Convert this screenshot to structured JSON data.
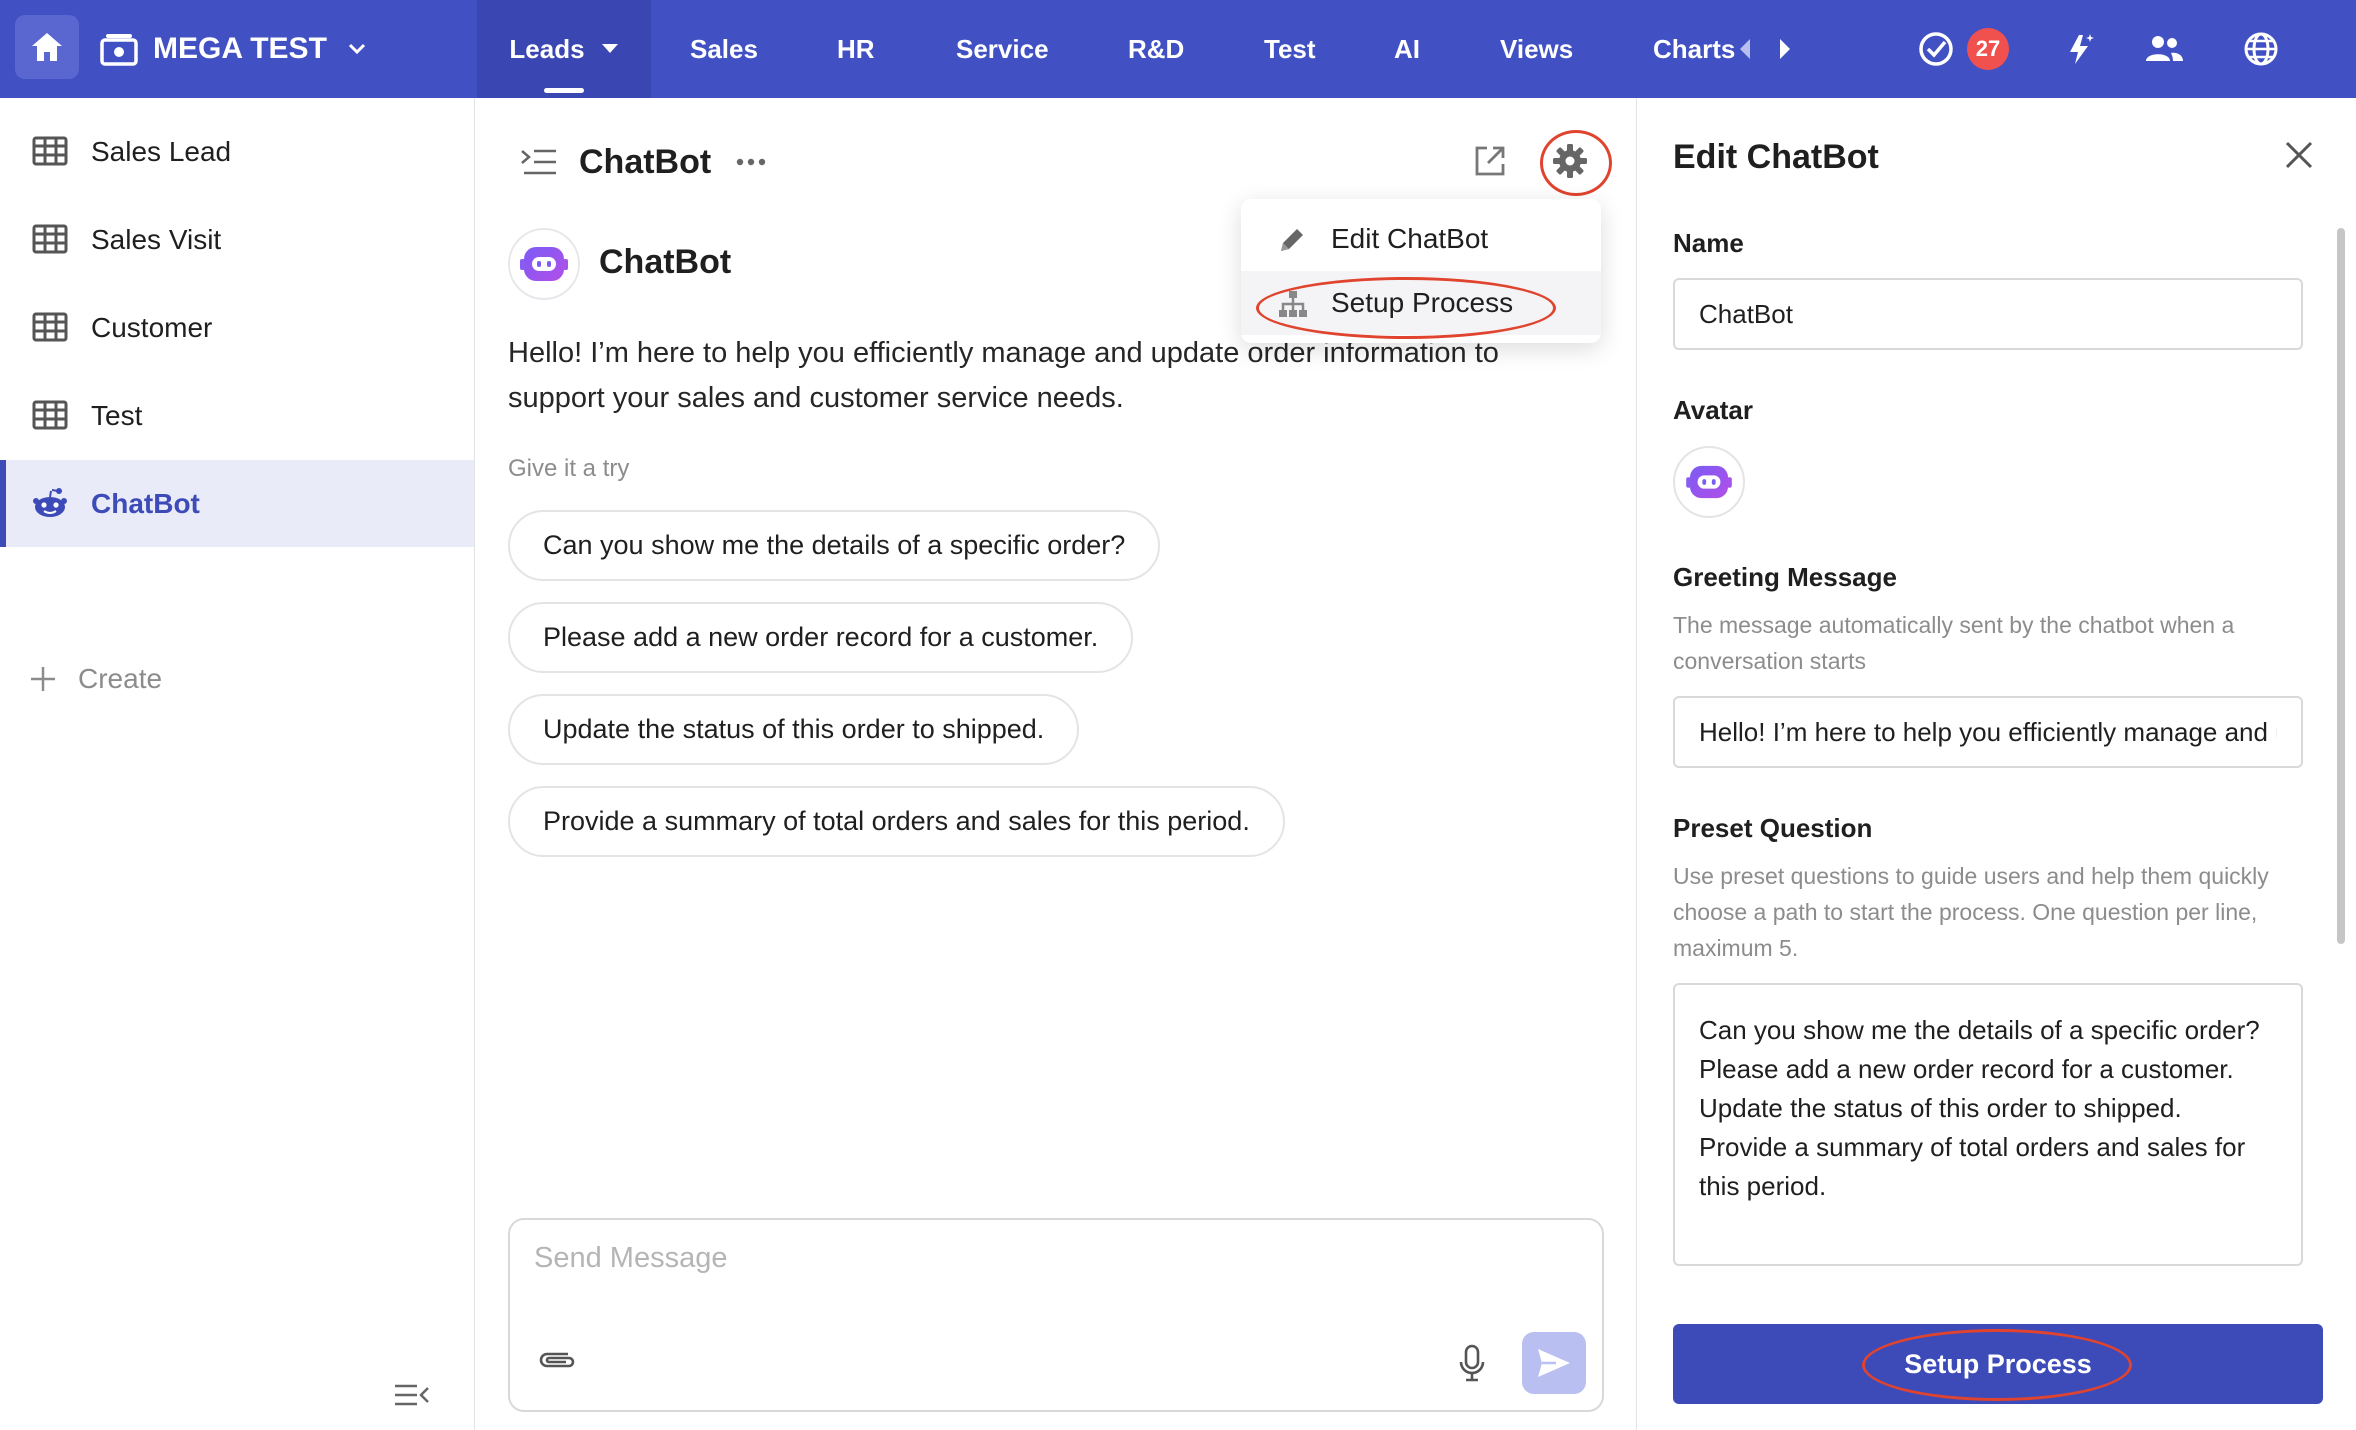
{
  "topbar": {
    "workspace_name": "MEGA TEST",
    "nav": [
      "Leads",
      "Sales",
      "HR",
      "Service",
      "R&D",
      "Test",
      "AI",
      "Views",
      "Charts"
    ],
    "notification_count": "27",
    "colors": {
      "bar": "#4150c2",
      "active_tab": "#3a47b3",
      "badge": "#f0514e"
    }
  },
  "sidebar": {
    "items": [
      {
        "label": "Sales Lead",
        "icon": "table-icon"
      },
      {
        "label": "Sales Visit",
        "icon": "table-icon"
      },
      {
        "label": "Customer",
        "icon": "table-icon"
      },
      {
        "label": "Test",
        "icon": "table-icon"
      },
      {
        "label": "ChatBot",
        "icon": "chatbot-icon",
        "active": true
      }
    ],
    "create_label": "Create"
  },
  "chat": {
    "title": "ChatBot",
    "bot_name": "ChatBot",
    "greeting": "Hello! I’m here to help you efficiently manage and update order information to support your sales and customer service needs.",
    "try_label": "Give it a try",
    "suggestions": [
      "Can you show me the details of a specific order?",
      "Please add a new order record for a customer.",
      "Update the status of this order to shipped.",
      "Provide a summary of total orders and sales for this period."
    ],
    "input_placeholder": "Send Message"
  },
  "menu": {
    "items": [
      "Edit ChatBot",
      "Setup Process"
    ]
  },
  "edit_panel": {
    "title": "Edit ChatBot",
    "name_label": "Name",
    "name_value": "ChatBot",
    "avatar_label": "Avatar",
    "greeting_label": "Greeting Message",
    "greeting_help": "The message automatically sent by the chatbot when a conversation starts",
    "greeting_value": "Hello! I’m here to help you efficiently manage and update order information to support your sales and customer service needs.",
    "preset_label": "Preset Question",
    "preset_help": "Use preset questions to guide users and help them quickly choose a path to start the process. One question per line, maximum 5.",
    "preset_value": "Can you show me the details of a specific order?\nPlease add a new order record for a customer.\nUpdate the status of this order to shipped.\nProvide a summary of total orders and sales for this period.",
    "primary_button": "Setup Process"
  }
}
